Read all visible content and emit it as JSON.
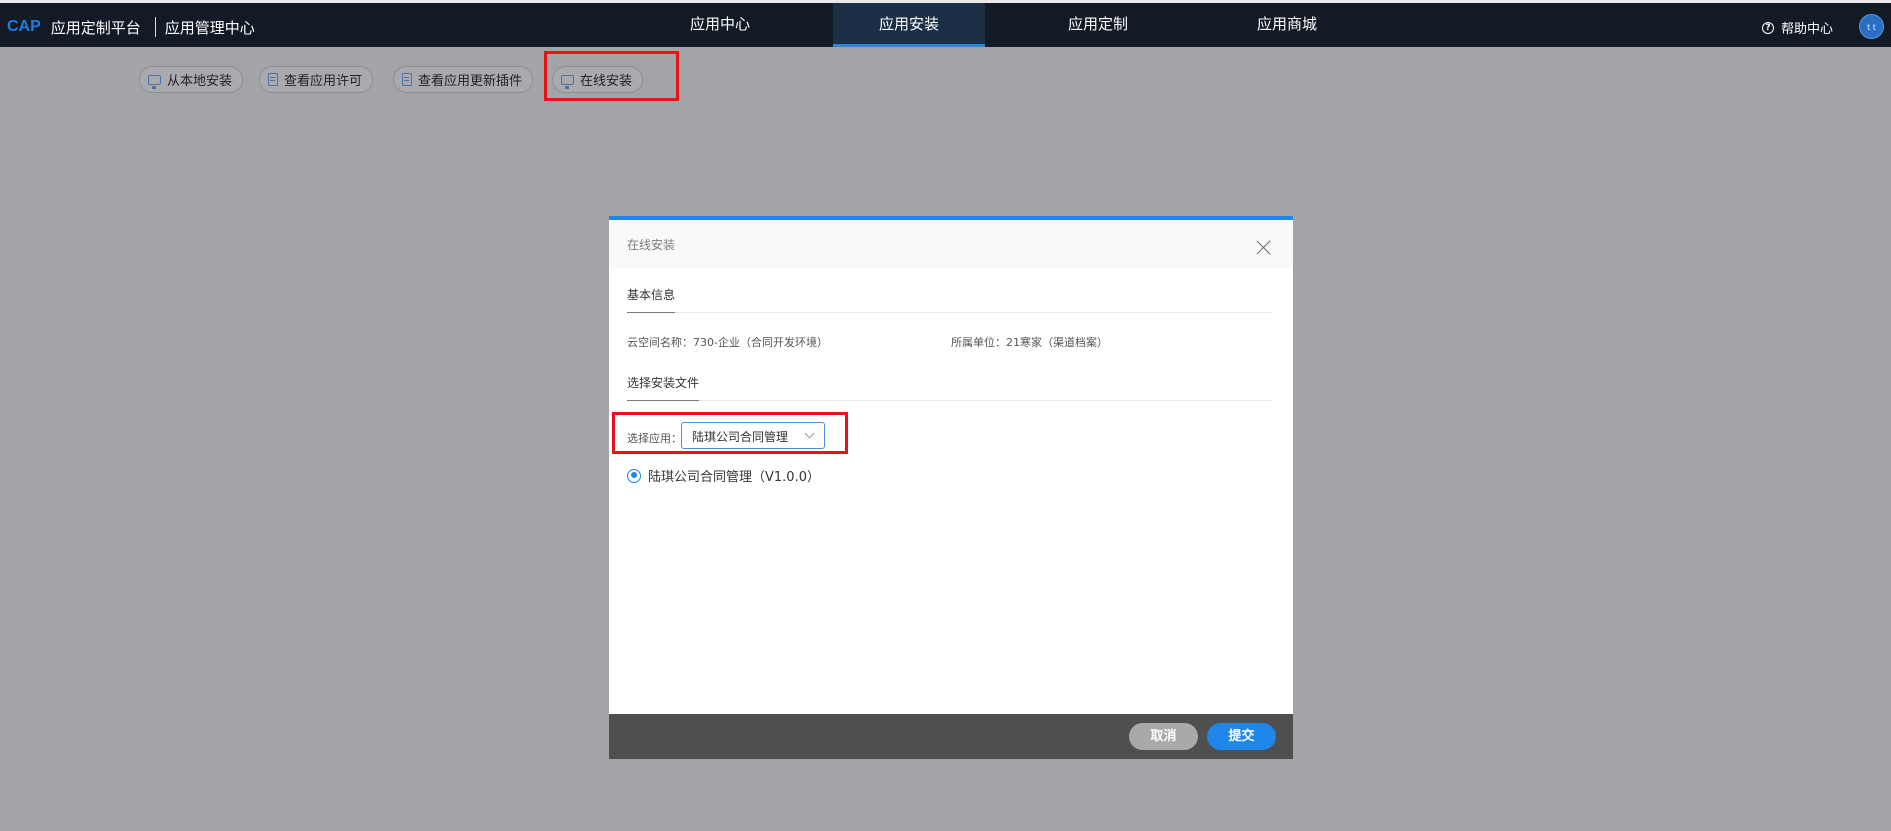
{
  "header": {
    "logo": "CAP",
    "platform_name": "应用定制平台",
    "center_name": "应用管理中心",
    "nav": [
      {
        "label": "应用中心",
        "active": false
      },
      {
        "label": "应用安装",
        "active": true
      },
      {
        "label": "应用定制",
        "active": false
      },
      {
        "label": "应用商城",
        "active": false
      }
    ],
    "help_label": "帮助中心",
    "avatar_text": "t t"
  },
  "toolbar": {
    "buttons": [
      {
        "label": "从本地安装",
        "icon": "monitor-icon"
      },
      {
        "label": "查看应用许可",
        "icon": "document-icon"
      },
      {
        "label": "查看应用更新插件",
        "icon": "document-icon"
      },
      {
        "label": "在线安装",
        "icon": "monitor-icon"
      }
    ]
  },
  "modal": {
    "title": "在线安装",
    "basic_section": "基本信息",
    "cloud_space": "云空间名称：730-企业（合同开发环境）",
    "unit": "所属单位：21寒家（渠道档案）",
    "file_section": "选择安装文件",
    "select_label": "选择应用：",
    "select_value": "陆琪公司合同管理",
    "option": "陆琪公司合同管理（V1.0.0）",
    "cancel_label": "取消",
    "submit_label": "提交"
  },
  "colors": {
    "accent": "#1f86ea",
    "highlight": "#e8131a",
    "topbar": "#121a26",
    "overlay": "#a3a4a8"
  }
}
